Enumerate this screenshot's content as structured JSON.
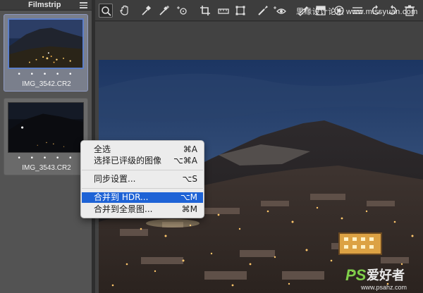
{
  "filmstrip": {
    "title": "Filmstrip",
    "thumbnails": [
      {
        "name": "IMG_3542.CR2",
        "rating_dots": "• • • • •",
        "selected": true
      },
      {
        "name": "IMG_3543.CR2",
        "rating_dots": "• • • • •",
        "selected": false
      }
    ]
  },
  "toolbar": {
    "tools": [
      "zoom-icon",
      "hand-icon",
      "white-balance-icon",
      "color-sampler-icon",
      "target-adjustment-icon",
      "crop-icon",
      "straighten-icon",
      "transform-icon",
      "spot-removal-icon",
      "red-eye-icon",
      "adjustment-brush-icon",
      "graduated-filter-icon",
      "radial-filter-icon",
      "preferences-icon",
      "rotate-left-icon",
      "rotate-right-icon",
      "trash-icon"
    ],
    "active_tool": "zoom-icon"
  },
  "context_menu": {
    "items": [
      {
        "label": "全选",
        "shortcut": "⌘A",
        "highlighted": false
      },
      {
        "label": "选择已评级的图像",
        "shortcut": "⌥⌘A",
        "highlighted": false
      },
      {
        "label": "同步设置...",
        "shortcut": "⌥S",
        "highlighted": false
      },
      {
        "label": "合并到 HDR...",
        "shortcut": "⌥M",
        "highlighted": true
      },
      {
        "label": "合并到全景图...",
        "shortcut": "⌘M",
        "highlighted": false
      }
    ]
  },
  "watermark": {
    "site_text": "思缘设计论坛 www.missyuan.com",
    "logo_text": "PS爱好者",
    "logo_url": "www.psahz.com"
  },
  "colors": {
    "highlight": "#1e63d6",
    "selected_border": "#5d7fc9",
    "panel_bg": "#535353",
    "toolbar_bg": "#3d3d3d"
  }
}
